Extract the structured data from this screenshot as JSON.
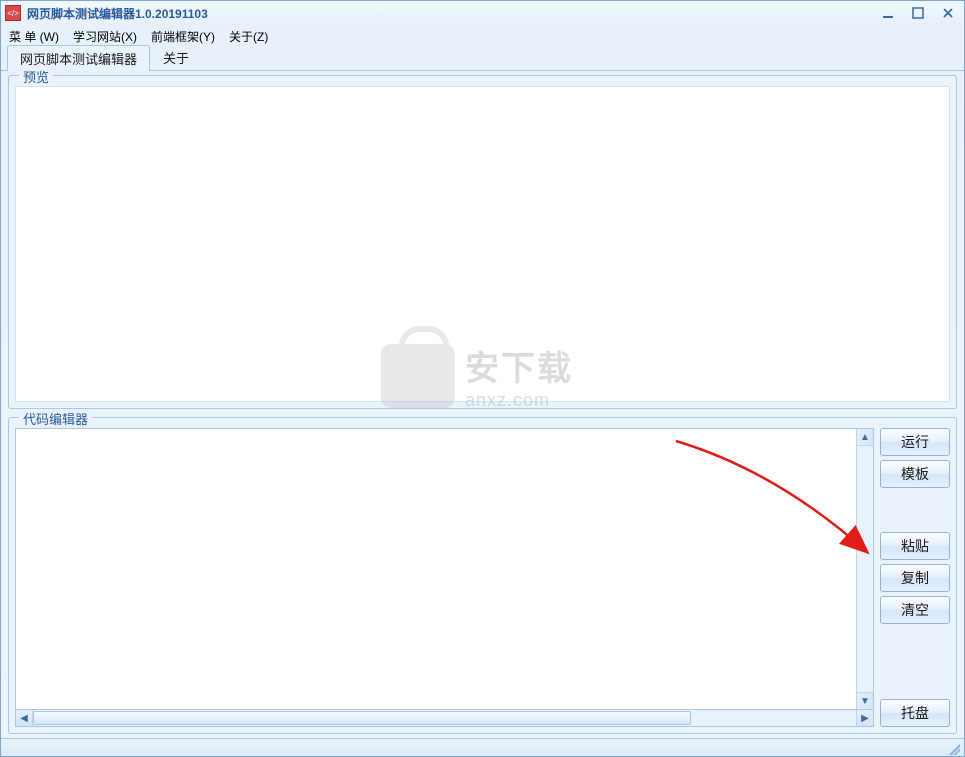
{
  "window": {
    "title": "网页脚本测试编辑器1.0.20191103"
  },
  "menubar": {
    "items": [
      {
        "label": "菜 单 (W)"
      },
      {
        "label": "学习网站(X)"
      },
      {
        "label": "前端框架(Y)"
      },
      {
        "label": "关于(Z)"
      }
    ]
  },
  "tabs": [
    {
      "label": "网页脚本测试编辑器",
      "active": true
    },
    {
      "label": "关于",
      "active": false
    }
  ],
  "panels": {
    "preview_legend": "预览",
    "editor_legend": "代码编辑器"
  },
  "buttons": {
    "run": "运行",
    "template": "模板",
    "paste": "粘贴",
    "copy": "复制",
    "clear": "清空",
    "tray": "托盘"
  },
  "editor": {
    "value": ""
  },
  "watermark": {
    "big": "安下载",
    "small": "anxz.com"
  }
}
